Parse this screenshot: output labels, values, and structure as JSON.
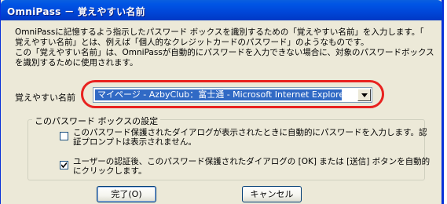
{
  "window": {
    "title": "OmniPass － 覚えやすい名前"
  },
  "intro_lines": [
    "OmniPassに記憶するよう指示したパスワード ボックスを識別するための「覚えやすい名前」を入力します。「",
    "覚えやすい名前」とは、例えば「個人的なクレジットカードのパスワード」のようなものです。",
    "この「覚えやすい名前」は、OmniPassが自動的にパスワードを入力できない場合に、対象のパスワードボックス",
    "を識別するために使用されます。"
  ],
  "name_field": {
    "label": "覚えやすい名前",
    "value": "マイページ - AzbyClub：富士通 - Microsoft Internet Explorer"
  },
  "settings": {
    "legend": "このパスワード ボックスの設定",
    "option1": {
      "checked": false,
      "line1": "このパスワード保護されたダイアログが表示されたときに自動的にパスワードを入力します。認",
      "line2": "証プロンプトは表示されません。"
    },
    "option2": {
      "checked": true,
      "line1": "ユーザーの認証後、このパスワード保護されたダイアログの [OK] または [送信] ボタンを自動的",
      "line2": "にクリックします。"
    }
  },
  "buttons": {
    "ok": "完了(O)",
    "cancel": "キャンセル"
  },
  "colors": {
    "title_bar": "#0054e3",
    "highlight_ring": "#e8221f",
    "selection": "#316ac5"
  }
}
